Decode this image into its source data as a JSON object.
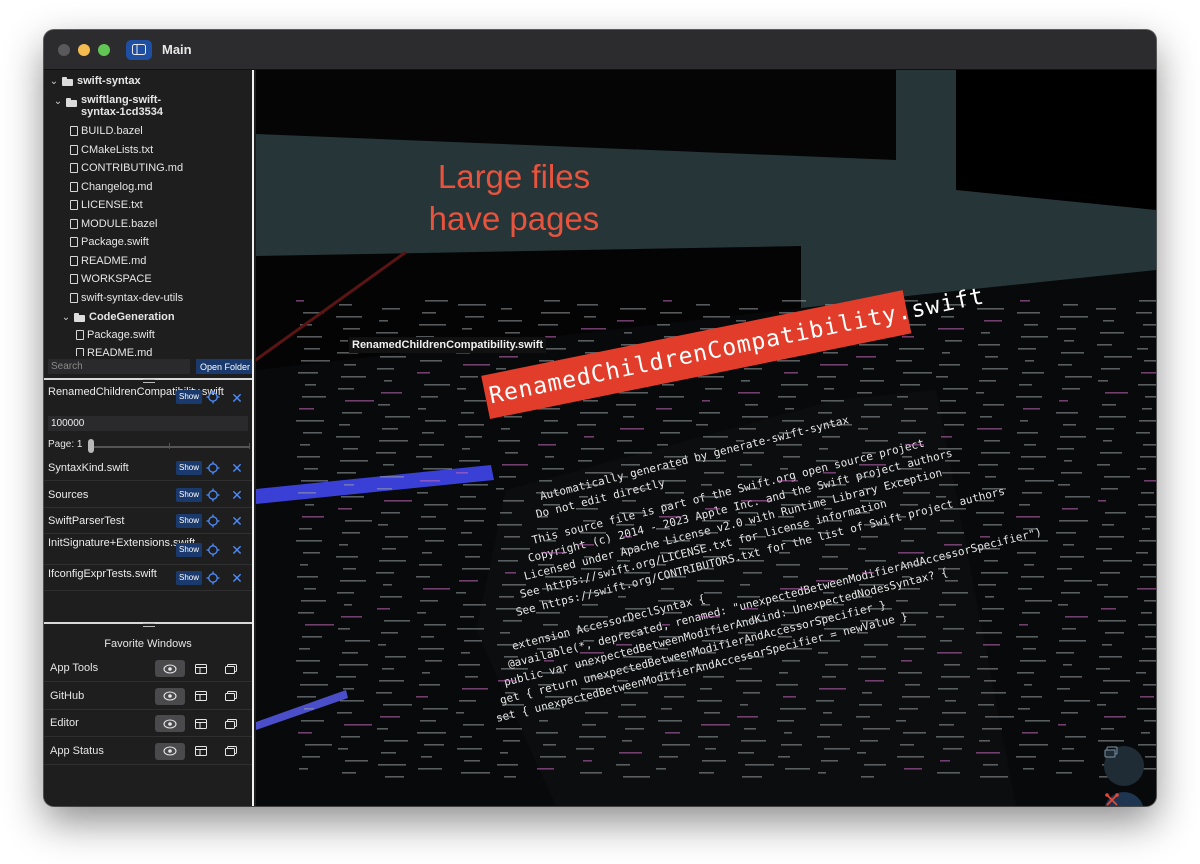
{
  "window": {
    "title": "Main"
  },
  "file_tree": {
    "root": "swift-syntax",
    "subfolder": "swiftlang-swift-syntax-1cd3534",
    "files": [
      "BUILD.bazel",
      "CMakeLists.txt",
      "CONTRIBUTING.md",
      "Changelog.md",
      "LICENSE.txt",
      "MODULE.bazel",
      "Package.swift",
      "README.md",
      "WORKSPACE",
      "swift-syntax-dev-utils"
    ],
    "open_folder": "CodeGeneration",
    "open_folder_files": [
      "Package.swift",
      "README.md"
    ]
  },
  "search": {
    "placeholder": "Search",
    "open_folder_label": "Open Folder"
  },
  "selected_item": {
    "name": "RenamedChildrenCompatibility.swift",
    "show_label": "Show",
    "value": "100000",
    "page_label": "Page: 1",
    "page": 1
  },
  "items": [
    {
      "name": "SyntaxKind.swift",
      "show_label": "Show"
    },
    {
      "name": "Sources",
      "show_label": "Show"
    },
    {
      "name": "SwiftParserTest",
      "show_label": "Show"
    },
    {
      "name": "InitSignature+Extensions.swift",
      "show_label": "Show"
    },
    {
      "name": "IfconfigExprTests.swift",
      "show_label": "Show"
    }
  ],
  "favorites": {
    "title": "Favorite Windows",
    "rows": [
      {
        "name": "App Tools"
      },
      {
        "name": "GitHub"
      },
      {
        "name": "Editor"
      },
      {
        "name": "App Status"
      }
    ]
  },
  "canvas": {
    "callout": "Large files\nhave pages",
    "small_label": "RenamedChildrenCompatibility.swift",
    "big_label": "RenamedChildrenCompatibility.swift",
    "code_lines": [
      "Automatically generated by generate-swift-syntax",
      "Do not edit directly",
      "This source file is part of the Swift.org open source project",
      "Copyright (c) 2014 - 2023 Apple Inc. and the Swift project authors",
      "Licensed under Apache License v2.0 with Runtime Library Exception",
      "See https://swift.org/LICENSE.txt for license information",
      "See https://swift.org/CONTRIBUTORS.txt for the list of Swift project authors",
      "extension AccessorDeclSyntax {",
      "@available(*, deprecated, renamed: \"unexpectedBetweenModifierAndAccessorSpecifier\")",
      "public var unexpectedBetweenModifierAndKind: UnexpectedNodesSyntax? {",
      "get { return unexpectedBetweenModifierAndAccessorSpecifier }",
      "set { unexpectedBetweenModifierAndAccessorSpecifier = newValue }"
    ]
  },
  "colors": {
    "accent": "#1f4fa3",
    "callout": "#e8533e",
    "big_label_bg": "#e23d2a",
    "close_x": "#4c8dff",
    "canvas_bg": "#263638"
  }
}
